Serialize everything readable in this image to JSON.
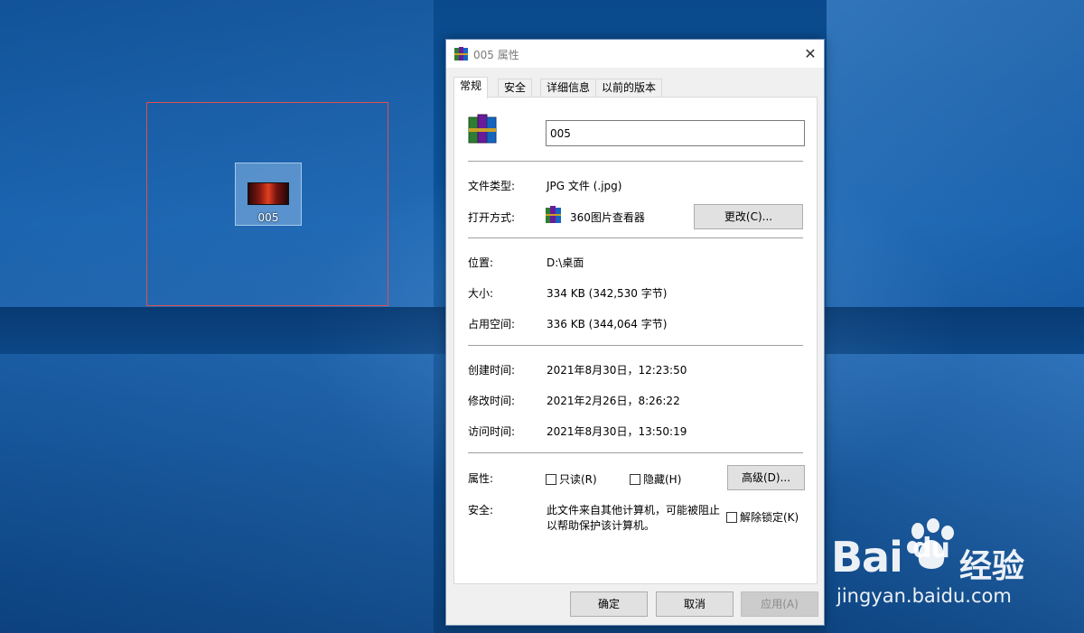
{
  "desktop": {
    "icon_label": "005",
    "watermark": {
      "brand_left": "Bai",
      "brand_right": "du",
      "brand_cn": "经验",
      "url": "jingyan.baidu.com"
    }
  },
  "dialog": {
    "title": "005 属性",
    "close_glyph": "✕",
    "tabs": [
      {
        "label": "常规"
      },
      {
        "label": "安全"
      },
      {
        "label": "详细信息"
      },
      {
        "label": "以前的版本"
      }
    ],
    "general": {
      "file_name": "005",
      "file_type_label": "文件类型:",
      "file_type_value": "JPG 文件 (.jpg)",
      "open_with_label": "打开方式:",
      "open_with_value": "360图片查看器",
      "change_button": "更改(C)...",
      "location_label": "位置:",
      "location_value": "D:\\桌面",
      "size_label": "大小:",
      "size_value": "334 KB (342,530 字节)",
      "size_on_disk_label": "占用空间:",
      "size_on_disk_value": "336 KB (344,064 字节)",
      "created_label": "创建时间:",
      "created_value": "2021年8月30日，12:23:50",
      "modified_label": "修改时间:",
      "modified_value": "2021年2月26日，8:26:22",
      "accessed_label": "访问时间:",
      "accessed_value": "2021年8月30日，13:50:19",
      "attributes_label": "属性:",
      "readonly_label": "只读(R)",
      "hidden_label": "隐藏(H)",
      "advanced_button": "高级(D)...",
      "security_label": "安全:",
      "security_text_line1": "此文件来自其他计算机，可能被阻止",
      "security_text_line2": "以帮助保护该计算机。",
      "unblock_label": "解除锁定(K)"
    },
    "footer": {
      "ok_button": "确定",
      "cancel_button": "取消",
      "apply_button": "应用(A)"
    }
  }
}
